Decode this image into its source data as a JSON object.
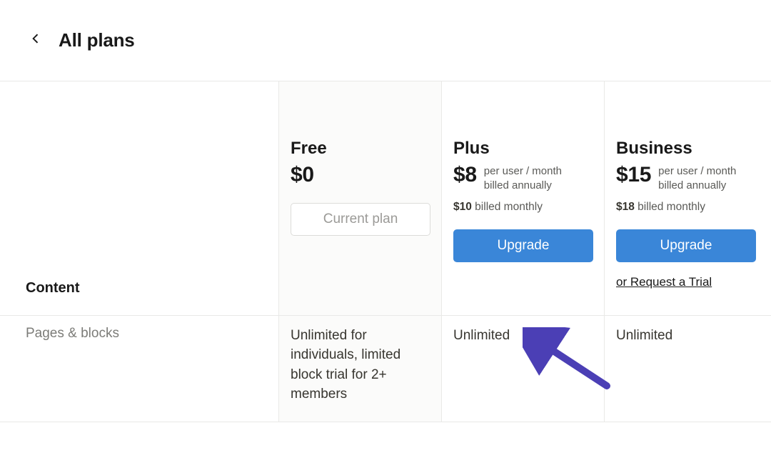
{
  "header": {
    "back_label": "back",
    "title": "All plans"
  },
  "plans": [
    {
      "name": "Free",
      "price": "$0",
      "per": "",
      "billed": "",
      "monthly_prefix": "",
      "monthly_suffix": "",
      "button_label": "Current plan",
      "button_kind": "current",
      "trial_label": ""
    },
    {
      "name": "Plus",
      "price": "$8",
      "per": "per user / month",
      "billed": "billed annually",
      "monthly_prefix": "$10",
      "monthly_suffix": " billed monthly",
      "button_label": "Upgrade",
      "button_kind": "primary",
      "trial_label": ""
    },
    {
      "name": "Business",
      "price": "$15",
      "per": "per user / month",
      "billed": "billed annually",
      "monthly_prefix": "$18",
      "monthly_suffix": " billed monthly",
      "button_label": "Upgrade",
      "button_kind": "primary",
      "trial_label": "or Request a Trial"
    }
  ],
  "section": {
    "title": "Content"
  },
  "feature": {
    "label": "Pages & blocks",
    "values": [
      "Unlimited for individuals, limited block trial for 2+ members",
      "Unlimited",
      "Unlimited"
    ]
  }
}
